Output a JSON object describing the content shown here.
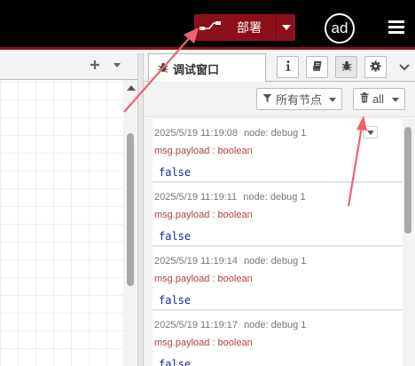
{
  "header": {
    "deploy_label": "部署",
    "avatar_text": "ad",
    "brand_color": "#8c101c"
  },
  "workspace": {
    "add_icon": "plus-icon",
    "menu_icon": "chevron-down-icon"
  },
  "sidebar": {
    "active_tab_label": "调试窗口",
    "tab_icons": [
      "info-icon",
      "book-icon",
      "bug-icon",
      "gear-icon",
      "chevron-down-icon"
    ],
    "filter_label": "所有节点",
    "clear_label": "all"
  },
  "debug_messages": [
    {
      "timestamp": "2025/5/19 11:19:08",
      "node": "node: debug 1",
      "topic": "msg.payload : boolean",
      "value": "false"
    },
    {
      "timestamp": "2025/5/19 11:19:11",
      "node": "node: debug 1",
      "topic": "msg.payload : boolean",
      "value": "false"
    },
    {
      "timestamp": "2025/5/19 11:19:14",
      "node": "node: debug 1",
      "topic": "msg.payload : boolean",
      "value": "false"
    },
    {
      "timestamp": "2025/5/19 11:19:17",
      "node": "node: debug 1",
      "topic": "msg.payload : boolean",
      "value": "false"
    }
  ],
  "colors": {
    "header_bg": "#000000",
    "annotation_arrow": "#f06070",
    "payload_value": "#1a1aa6",
    "topic_text": "#a94442"
  }
}
